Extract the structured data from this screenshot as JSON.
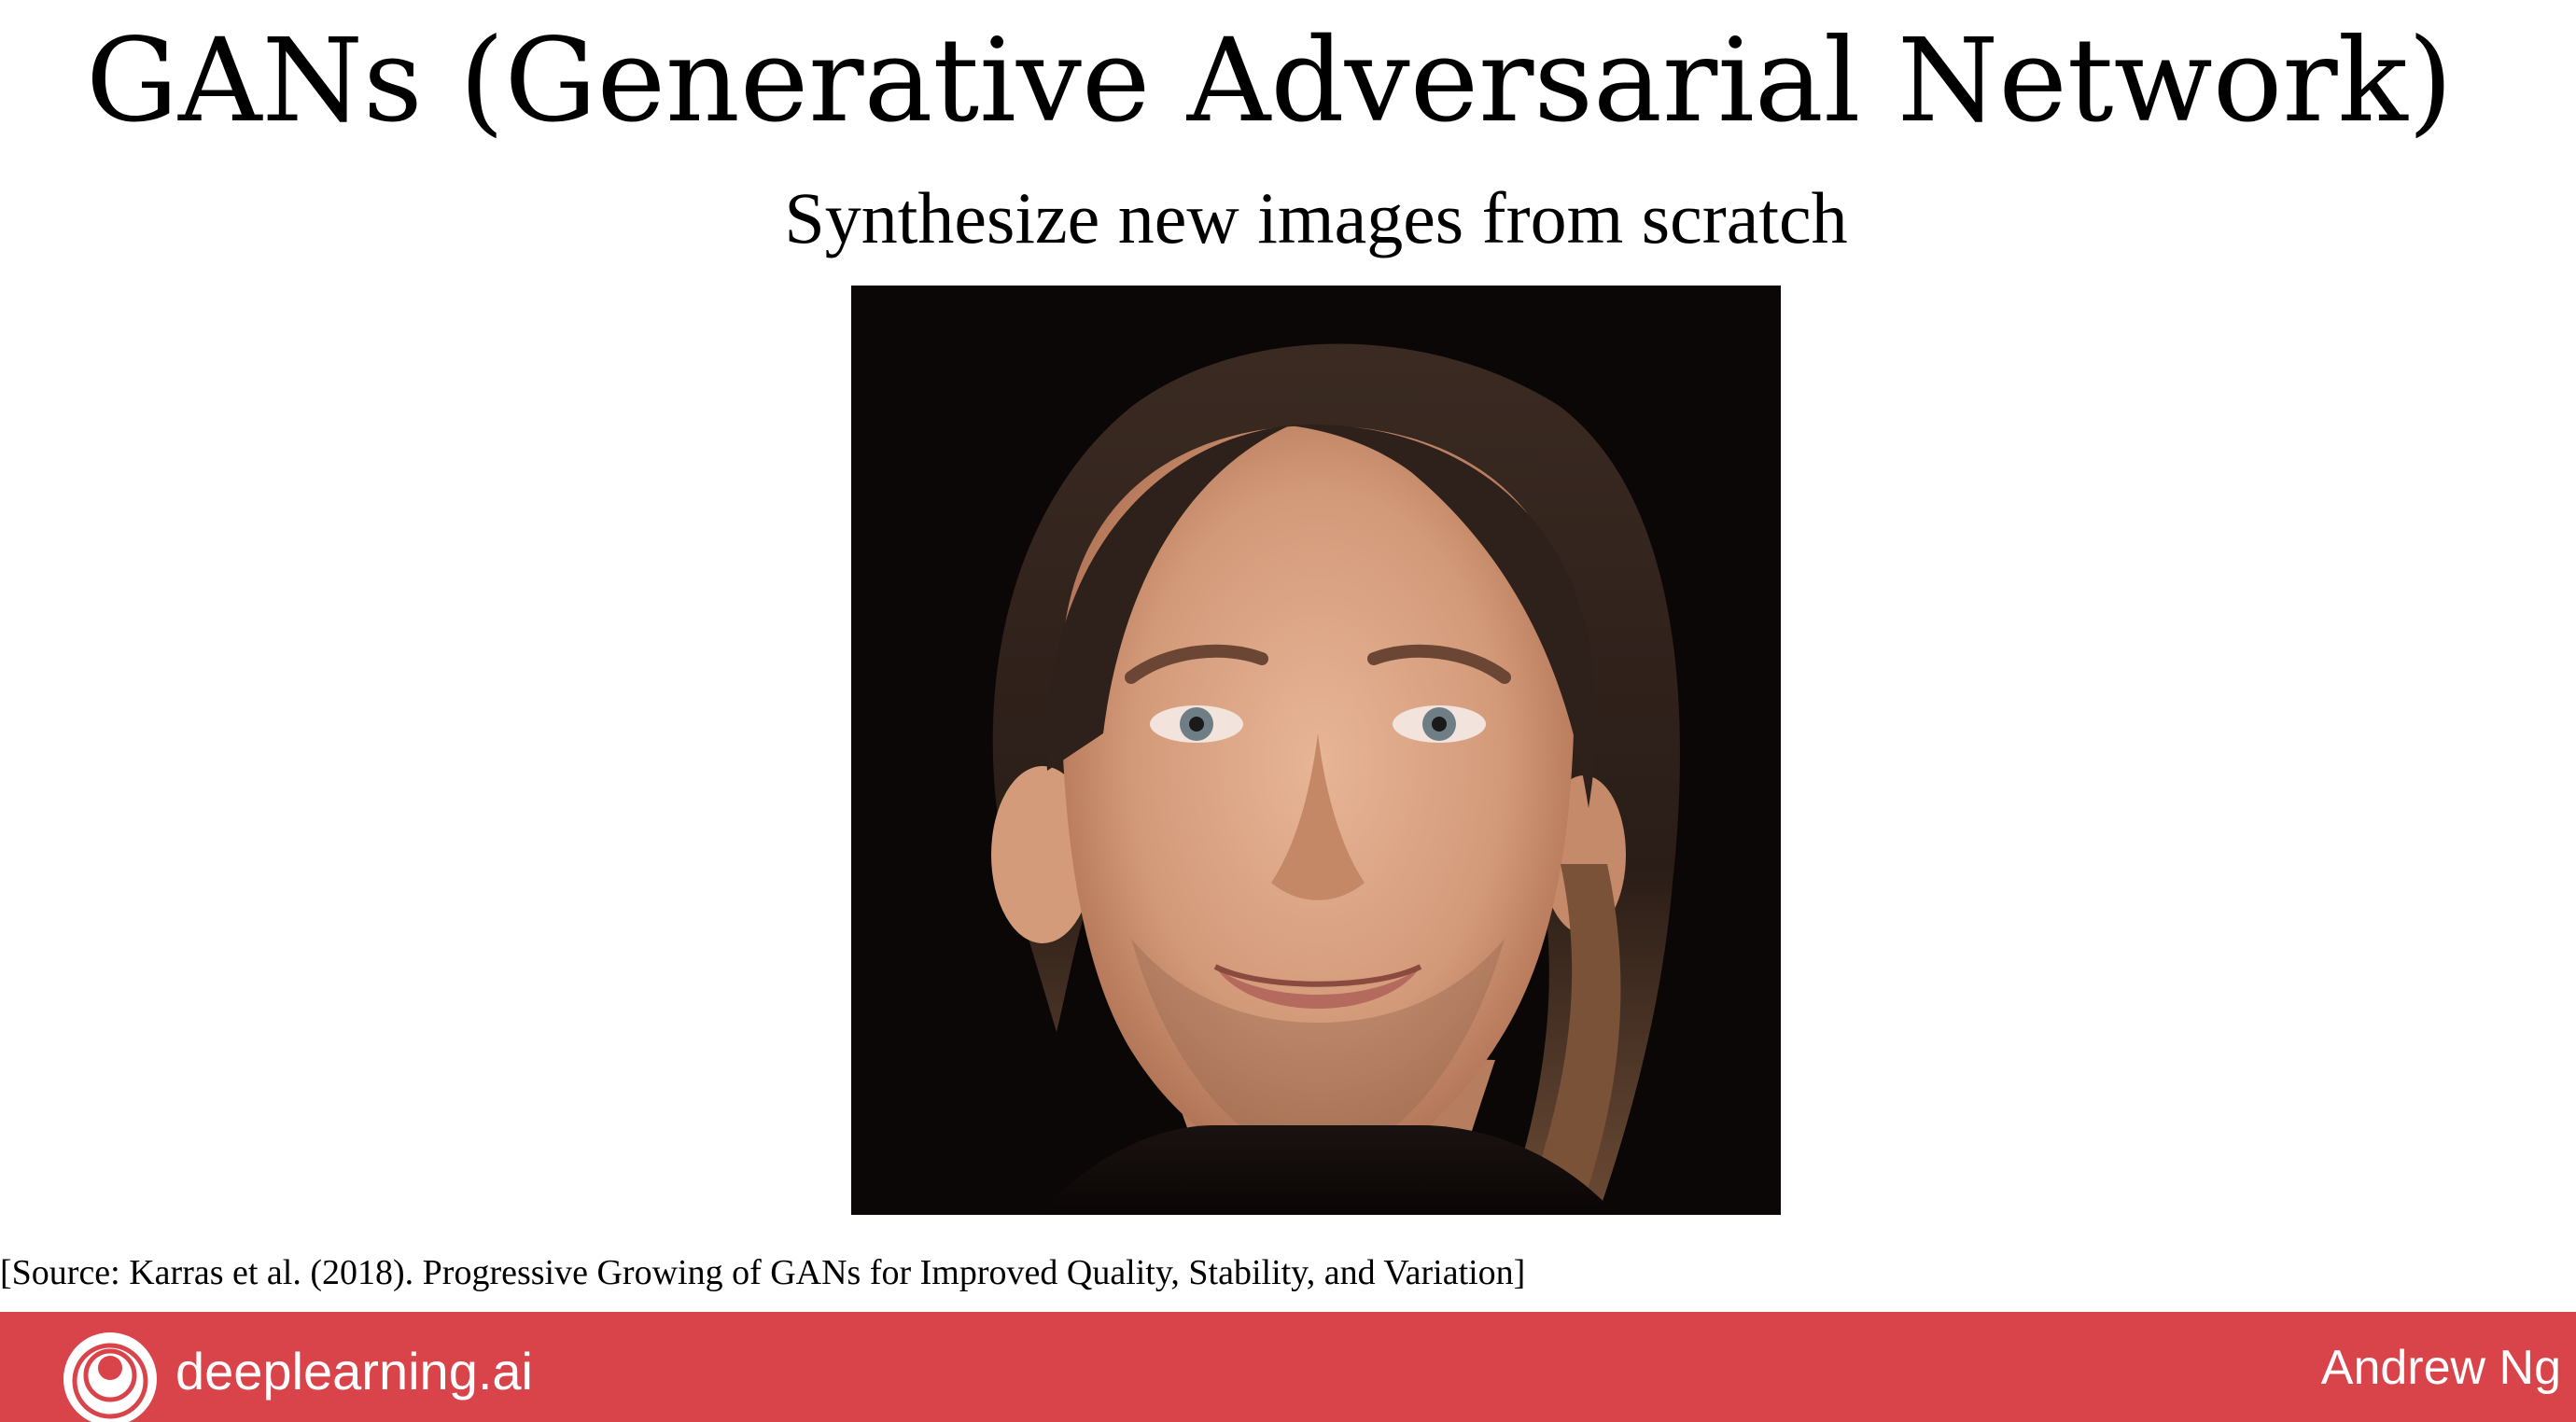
{
  "slide": {
    "title": "GANs (Generative Adversarial Network)",
    "subtitle": "Synthesize new images from scratch",
    "source": "[Source: Karras et al. (2018). Progressive Growing of GANs for Improved Quality, Stability, and Variation]"
  },
  "footer": {
    "brand": "deeplearning.ai",
    "author": "Andrew Ng",
    "logo_icon": "deeplearning-ai-logo-icon",
    "background_color": "#d9434a"
  },
  "image": {
    "subject": "GAN-generated portrait of a smiling man with long dark hair on a black background"
  }
}
